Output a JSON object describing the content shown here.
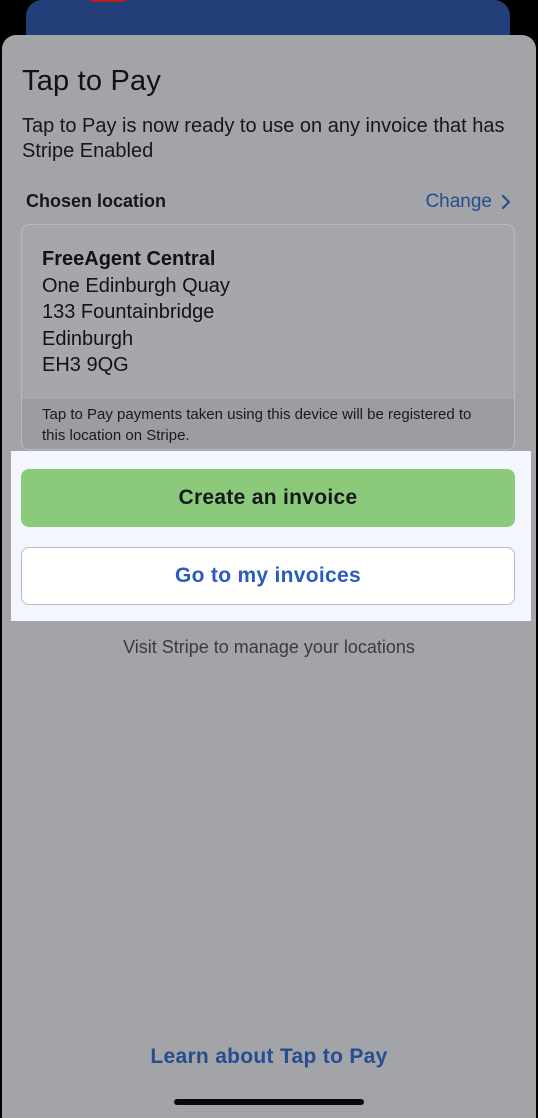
{
  "sheet": {
    "title": "Tap to Pay",
    "description": "Tap to Pay is now ready to use on any invoice that has Stripe Enabled"
  },
  "location": {
    "heading": "Chosen location",
    "change_label": "Change",
    "name": "FreeAgent Central",
    "address_lines": [
      "One Edinburgh Quay",
      "133 Fountainbridge",
      "Edinburgh",
      "EH3 9QG"
    ],
    "note": "Tap to Pay payments taken using this device will be registered to this location on Stripe."
  },
  "actions": {
    "create_invoice_label": "Create an invoice",
    "go_to_invoices_label": "Go to my invoices"
  },
  "visit_stripe_text": "Visit Stripe to manage your locations",
  "learn_link_label": "Learn about Tap to Pay",
  "icons": {
    "change": "chevron-right-icon"
  },
  "colors": {
    "primary_button": "#8bca7b",
    "link": "#274c91",
    "secondary_button_text": "#2a5cbf",
    "highlight": "#f3f6fc"
  }
}
